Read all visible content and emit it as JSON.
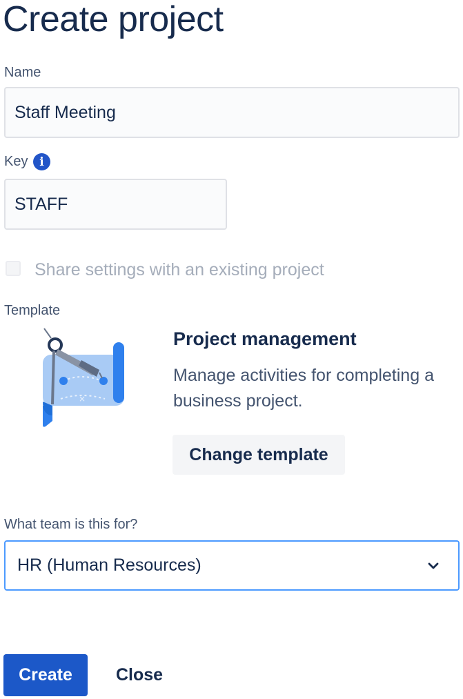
{
  "page": {
    "title": "Create project"
  },
  "name_field": {
    "label": "Name",
    "value": "Staff Meeting"
  },
  "key_field": {
    "label": "Key",
    "info_icon": "info-icon",
    "info_glyph": "i",
    "value": "STAFF"
  },
  "share_settings": {
    "label": "Share settings with an existing project",
    "checked": false,
    "disabled": true
  },
  "template": {
    "label": "Template",
    "illustration": "blueprint-compass-illustration",
    "name": "Project management",
    "description": "Manage activities for completing a business project.",
    "change_label": "Change template"
  },
  "team_select": {
    "label": "What team is this for?",
    "selected": "HR (Human Resources)",
    "icon": "chevron-down-icon"
  },
  "actions": {
    "create_label": "Create",
    "close_label": "Close"
  },
  "colors": {
    "primary": "#1c58c8",
    "heading": "#172b4d",
    "focus_border": "#4c9aff",
    "muted_text": "#a5adba"
  }
}
